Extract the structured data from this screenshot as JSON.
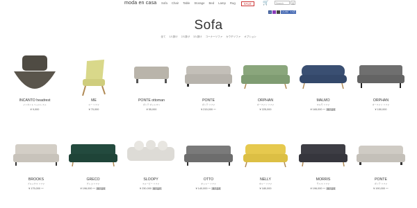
{
  "header": {
    "logo": "moda en casa",
    "nav": [
      "Sofa",
      "Chair",
      "Table",
      "Storage",
      "Bed",
      "Lamp",
      "Rug"
    ],
    "sale": "SALE",
    "search_placeholder": "Search",
    "search_button": "Q"
  },
  "social": {
    "like": "いいね！ 1.3万"
  },
  "page": {
    "title": "Sofa",
    "subnav": [
      "全て",
      "1人掛け",
      "2人掛け",
      "3人掛け",
      "コーナーソファ",
      "カウチソファ",
      "オプション"
    ]
  },
  "colors": {
    "accent": "#c33333",
    "text": "#333333"
  },
  "products": [
    {
      "name": "INCANTO headrest",
      "kana": "インカント ヘッドレスト",
      "price": "¥ 9,000",
      "badge": ""
    },
    {
      "name": "ME",
      "kana": "ミー ソファ",
      "price": "¥ 70,000",
      "badge": ""
    },
    {
      "name": "PONTE ottoman",
      "kana": "ポンテ オットマン",
      "price": "¥ 55,000",
      "badge": ""
    },
    {
      "name": "PONTE",
      "kana": "ポンテ ソファ",
      "price": "¥ 215,000 〜",
      "badge": ""
    },
    {
      "name": "ORPHAN",
      "kana": "オーファン ソファ",
      "price": "¥ 225,000",
      "badge": ""
    },
    {
      "name": "MALMO",
      "kana": "マルモ ソファ",
      "price": "¥ 165,000 〜",
      "badge": "展示品有"
    },
    {
      "name": "ORPHAN",
      "kana": "オーファン ソファ",
      "price": "¥ 150,000",
      "badge": ""
    },
    {
      "name": "BROOKS",
      "kana": "ブルックス ソファ",
      "price": "¥ 175,000 〜",
      "badge": ""
    },
    {
      "name": "GRECO",
      "kana": "グレコ ソファ",
      "price": "¥ 196,000 〜",
      "badge": "展示品有"
    },
    {
      "name": "SLOOPY",
      "kana": "スルーピー ソファ",
      "price": "¥ 230,000",
      "badge": "展示品有"
    },
    {
      "name": "OTTO",
      "kana": "オットー ソファ",
      "price": "¥ 140,000 〜",
      "badge": "展示品有"
    },
    {
      "name": "NELLY",
      "kana": "ネリー ソファ",
      "price": "¥ 180,000",
      "badge": ""
    },
    {
      "name": "MORRIS",
      "kana": "モリス ソファ",
      "price": "¥ 196,000 〜",
      "badge": "展示品有"
    },
    {
      "name": "PONTE",
      "kana": "ポンテ ソファ",
      "price": "¥ 190,000 〜",
      "badge": ""
    }
  ]
}
